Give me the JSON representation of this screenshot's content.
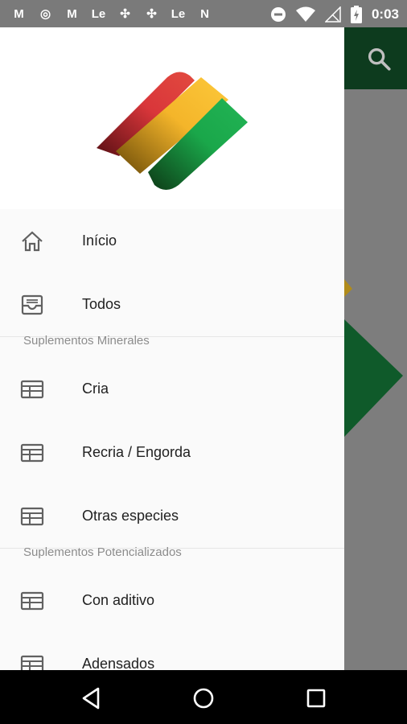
{
  "status_bar": {
    "time": "0:03",
    "left_icons": [
      "gmail-icon",
      "chrome-icon",
      "gmail-icon",
      "le-icon",
      "pinwheel-icon",
      "pinwheel-icon",
      "le-icon",
      "n-icon"
    ]
  },
  "drawer": {
    "menu": [
      {
        "label": "Início",
        "icon": "home-icon"
      },
      {
        "label": "Todos",
        "icon": "inbox-icon"
      }
    ],
    "sections": [
      {
        "title": "Suplementos Minerales",
        "items": [
          {
            "label": "Cria",
            "icon": "table-icon"
          },
          {
            "label": "Recria / Engorda",
            "icon": "table-icon"
          },
          {
            "label": "Otras especies",
            "icon": "table-icon"
          }
        ]
      },
      {
        "title": "Suplementos Potencializados",
        "items": [
          {
            "label": "Con aditivo",
            "icon": "table-icon"
          },
          {
            "label": "Adensados",
            "icon": "table-icon"
          }
        ]
      }
    ]
  },
  "colors": {
    "toolbar": "#0d3b1e",
    "logo_red": "#d9363a",
    "logo_yellow": "#fbbf2e",
    "logo_green": "#1aa74a"
  }
}
